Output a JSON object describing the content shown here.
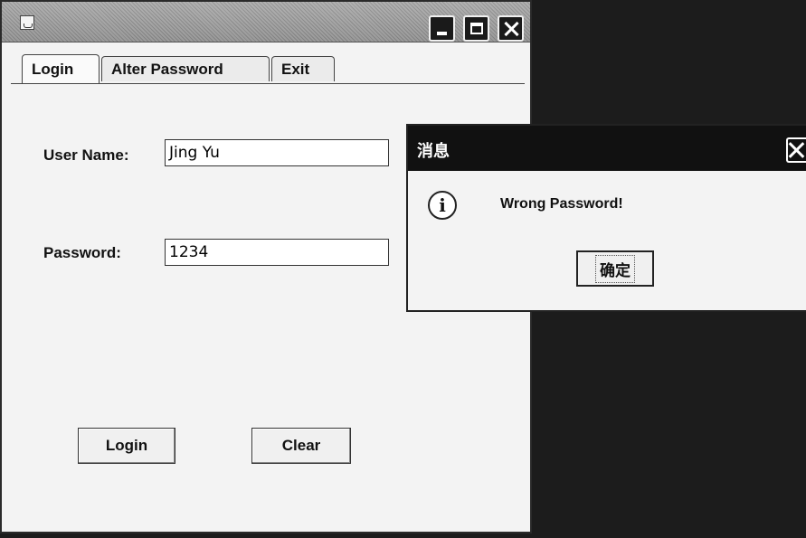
{
  "main_window": {
    "icons": {
      "app": "java-cup-icon",
      "minimize": "minimize-icon",
      "maximize": "maximize-icon",
      "close": "close-icon"
    },
    "tabs": [
      {
        "label": "Login",
        "active": true
      },
      {
        "label": "Alter Password",
        "active": false
      },
      {
        "label": "Exit",
        "active": false
      }
    ],
    "form": {
      "username_label": "User Name:",
      "username_value": "Jing Yu",
      "password_label": "Password:",
      "password_value": "1234"
    },
    "buttons": {
      "login": "Login",
      "clear": "Clear"
    }
  },
  "dialog": {
    "title": "消息",
    "message": "Wrong Password!",
    "ok_label": "确定",
    "icons": {
      "info": "info-icon",
      "close": "close-icon"
    }
  }
}
